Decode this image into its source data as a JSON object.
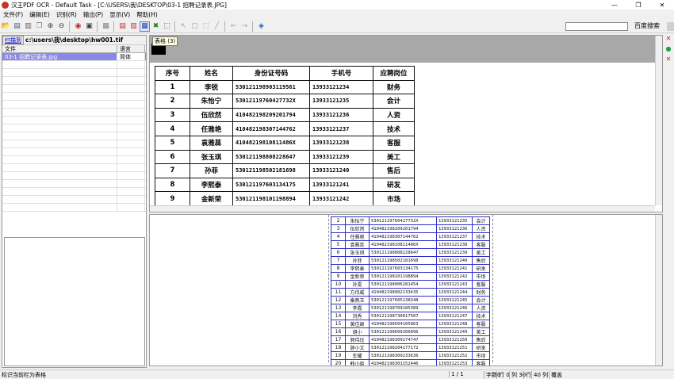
{
  "window": {
    "title": "汉王PDF OCR - Default Task - [C:\\USERS\\我\\DESKTOP\\03-1 招聘记录表.JPG]",
    "minimize": "—",
    "maximize": "❐",
    "close": "✕"
  },
  "menu": [
    "文件(F)",
    "编辑(E)",
    "识别(R)",
    "输出(P)",
    "显示(V)",
    "帮助(H)"
  ],
  "search": {
    "value": "",
    "button": "百度搜索"
  },
  "left": {
    "scan_label": "扫描到",
    "path": "c:\\users\\我\\desktop\\hw001.tif",
    "columns": [
      "文件",
      "语言"
    ],
    "files": [
      {
        "name": "03-1 招聘记录表.jpg",
        "lang": "简体"
      }
    ]
  },
  "tooltip": "表格 (3)",
  "table": {
    "headers": [
      "序号",
      "姓名",
      "身份证号码",
      "手机号",
      "应聘岗位"
    ],
    "rows": [
      [
        "1",
        "李锐",
        "530121198903119561",
        "13933121234",
        "财务"
      ],
      [
        "2",
        "朱怡宁",
        "53012119760427732X",
        "13933121235",
        "会计"
      ],
      [
        "3",
        "伍欣然",
        "410482198209201794",
        "13933121236",
        "人资"
      ],
      [
        "4",
        "任雅艳",
        "410482198307144762",
        "13933121237",
        "技术"
      ],
      [
        "5",
        "袁雅蕊",
        "41048219810811486X",
        "13933121238",
        "客服"
      ],
      [
        "6",
        "张玉琪",
        "530121198808228647",
        "13933121239",
        "美工"
      ],
      [
        "7",
        "孙菲",
        "530121198502181698",
        "13933121240",
        "售后"
      ],
      [
        "8",
        "李熙泰",
        "530121197603134175",
        "13933121241",
        "研发"
      ],
      [
        "9",
        "金新荣",
        "530121198101198894",
        "13933121242",
        "市场"
      ]
    ]
  },
  "mini_table": {
    "rows": [
      [
        "2",
        "朱怡宁",
        "53012119760427732X",
        "13933121235",
        "会计"
      ],
      [
        "3",
        "伍欣然",
        "410482198209201794",
        "13933121236",
        "人资"
      ],
      [
        "4",
        "任雅艳",
        "410482198307144762",
        "13933121237",
        "技术"
      ],
      [
        "5",
        "袁雅蕊",
        "41048219810811486X",
        "13933121238",
        "客服"
      ],
      [
        "6",
        "张玉琪",
        "530121198808228647",
        "13933121239",
        "美工"
      ],
      [
        "7",
        "孙菲",
        "530121198502181698",
        "13933121240",
        "售后"
      ],
      [
        "8",
        "李熙泰",
        "530121197603134175",
        "13933121241",
        "研发"
      ],
      [
        "9",
        "金新荣",
        "530121198101198894",
        "13933121242",
        "市场"
      ],
      [
        "10",
        "孙雯",
        "530121198006281454",
        "13933121243",
        "客服"
      ],
      [
        "11",
        "方伟威",
        "410482198902133435",
        "13933121244",
        "财务"
      ],
      [
        "12",
        "秦燕玉",
        "530121197605138348",
        "13933121245",
        "会计"
      ],
      [
        "13",
        "李霞",
        "530121198709185389",
        "13933121246",
        "人资"
      ],
      [
        "14",
        "刘秀",
        "530121198730817507",
        "13933121247",
        "技术"
      ],
      [
        "15",
        "黄佳颖",
        "410482198504105863",
        "13933121248",
        "客服"
      ],
      [
        "16",
        "胡小",
        "530121198609206896",
        "13933121249",
        "美工"
      ],
      [
        "17",
        "郭伟珏",
        "410482198309274747",
        "13933121250",
        "售后"
      ],
      [
        "18",
        "顾小文",
        "530121198204177172",
        "13933121251",
        "研发"
      ],
      [
        "19",
        "车耀",
        "530121198309233636",
        "13933121252",
        "市场"
      ],
      [
        "20",
        "韩小晓",
        "410482198301152446",
        "13933121253",
        "客服"
      ]
    ]
  },
  "status": {
    "message": "标识当前栏为表格",
    "page": "1 / 1",
    "cells": [
      "字数0",
      "行 0",
      "列 30",
      "行",
      "40 列",
      "覆盖"
    ]
  },
  "icons": [
    "open-icon",
    "save-icon",
    "scan-icon",
    "zoom-in-icon",
    "zoom-out-icon",
    "rotate-icon",
    "text-region-icon",
    "image-region-icon",
    "table-region-icon",
    "delete-region-icon",
    "select-icon",
    "pen-icon",
    "back-icon",
    "forward-icon",
    "recognize-icon"
  ]
}
